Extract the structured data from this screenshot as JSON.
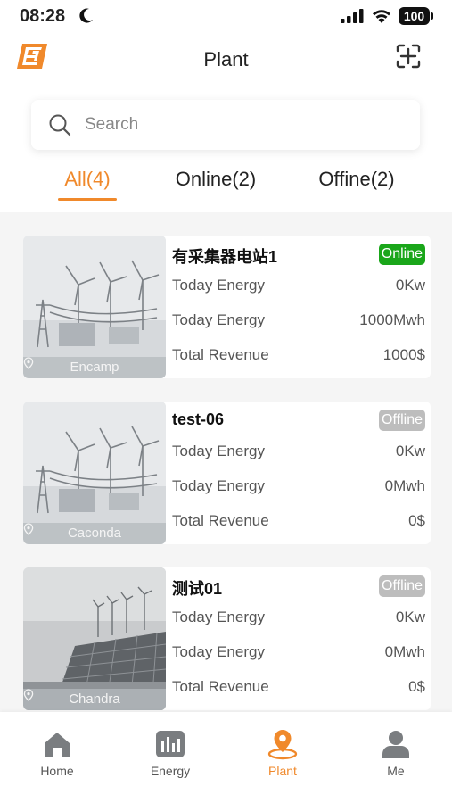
{
  "status_bar": {
    "time": "08:28",
    "battery": "100"
  },
  "header": {
    "title": "Plant"
  },
  "search": {
    "placeholder": "Search"
  },
  "tabs": [
    {
      "label": "All(4)",
      "active": true
    },
    {
      "label": "Online(2)",
      "active": false
    },
    {
      "label": "Offine(2)",
      "active": false
    }
  ],
  "plants": [
    {
      "name": "有采集器电站1",
      "status": "Online",
      "location": "Encamp",
      "rows": [
        {
          "label": "Today Energy",
          "value": "0Kw"
        },
        {
          "label": "Today Energy",
          "value": "1000Mwh"
        },
        {
          "label": "Total Revenue",
          "value": "1000$"
        }
      ]
    },
    {
      "name": "test-06",
      "status": "Offline",
      "location": "Caconda",
      "rows": [
        {
          "label": "Today Energy",
          "value": "0Kw"
        },
        {
          "label": "Today Energy",
          "value": "0Mwh"
        },
        {
          "label": "Total Revenue",
          "value": "0$"
        }
      ]
    },
    {
      "name": "测试01",
      "status": "Offline",
      "location": "Chandra",
      "rows": [
        {
          "label": "Today Energy",
          "value": "0Kw"
        },
        {
          "label": "Today Energy",
          "value": "0Mwh"
        },
        {
          "label": "Total Revenue",
          "value": "0$"
        }
      ]
    }
  ],
  "nav": [
    {
      "label": "Home",
      "icon": "home-icon"
    },
    {
      "label": "Energy",
      "icon": "energy-icon"
    },
    {
      "label": "Plant",
      "icon": "plant-pin-icon",
      "active": true
    },
    {
      "label": "Me",
      "icon": "user-icon"
    }
  ],
  "colors": {
    "accent": "#f0892b",
    "online": "#1aa61a",
    "offline": "#bdbdbd"
  }
}
